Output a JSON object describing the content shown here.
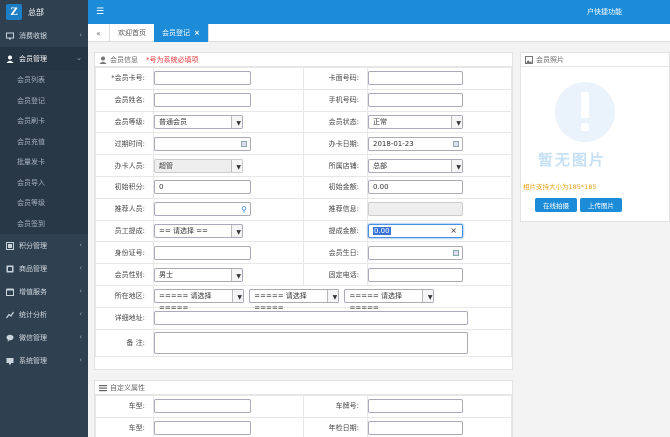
{
  "sidebar": {
    "brand": "总部",
    "items": [
      {
        "label": "消费收银",
        "icon": "monitor-icon"
      },
      {
        "label": "会员管理",
        "icon": "member-icon",
        "open": true
      },
      {
        "label": "积分管理",
        "icon": "points-icon"
      },
      {
        "label": "商品管理",
        "icon": "goods-icon"
      },
      {
        "label": "增值服务",
        "icon": "value-added-icon"
      },
      {
        "label": "统计分析",
        "icon": "stats-icon"
      },
      {
        "label": "微信管理",
        "icon": "wechat-icon"
      },
      {
        "label": "系统管理",
        "icon": "system-icon"
      }
    ],
    "submenu": [
      "会员列表",
      "会员登记",
      "会员刷卡",
      "会员充值",
      "批量发卡",
      "会员导入",
      "会员等级",
      "会员签到"
    ]
  },
  "topbar": {
    "quick": "户快捷功能"
  },
  "tabs": {
    "home": "欢迎首页",
    "current": "会员登记",
    "close": "×"
  },
  "form": {
    "section_title": "会员信息",
    "hint": "*号为系统必填项",
    "card_no": "*会员卡号:",
    "card_face_no": "卡面号码:",
    "name": "会员姓名:",
    "mobile": "手机号码:",
    "level_label": "会员等级:",
    "level_value": "普通会员",
    "status_label": "会员状态:",
    "status_value": "正常",
    "expire": "过期时间:",
    "open_date_label": "办卡日期:",
    "open_date_value": "2018-01-23",
    "staff_label": "办卡人员:",
    "staff_value": "超管",
    "store_label": "所属店铺:",
    "store_value": "总部",
    "init_points_label": "初始积分:",
    "init_points_value": "0",
    "init_amount_label": "初始金额:",
    "init_amount_value": "0.00",
    "referrer": "推荐人员:",
    "referrer_info": "推荐信息:",
    "employee_label": "员工提成:",
    "employee_value": "== 请选择 ==",
    "commission_label": "提成金额:",
    "commission_value": "0.00",
    "id_no": "身份证号:",
    "birthday": "会员生日:",
    "gender_label": "会员性别:",
    "gender_value": "男士",
    "phone": "固定电话:",
    "region_label": "所在地区:",
    "region_placeholder": "===== 请选择 =====",
    "address": "详细地址:",
    "remark": "备 注:"
  },
  "custom": {
    "section_title": "自定义属性",
    "model": "车型:",
    "plate": "车牌号:",
    "vehicle": "车型:",
    "year": "年检日期:"
  },
  "photo": {
    "title": "会员照片",
    "placeholder": "暂无图片",
    "note": "相片支持大小为185*185",
    "btn_shoot": "在线拍摄",
    "btn_upload": "上传图片"
  },
  "colors": {
    "sidebar": "#2f4050",
    "accent": "#1d8cd8",
    "hint": "#e4393c"
  }
}
